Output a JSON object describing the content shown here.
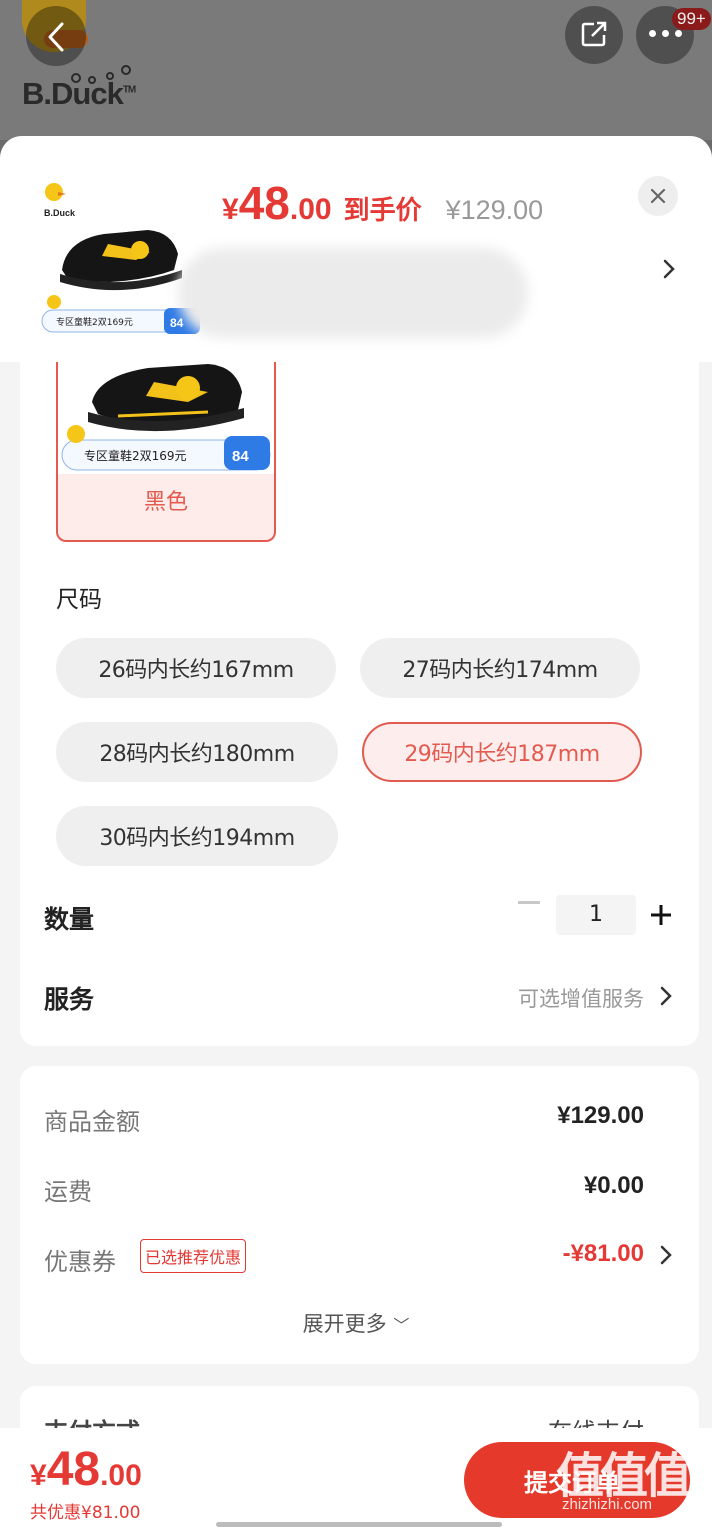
{
  "background": {
    "brand": "B.Duck",
    "trademark": "TM",
    "notification_badge": "99+"
  },
  "header": {
    "price_symbol": "¥",
    "price_integer": "48",
    "price_decimal": ".00",
    "price_tag": "到手价",
    "original_price": "¥129.00"
  },
  "thumbnail": {
    "brand": "B.Duck",
    "promo_text": "专区童鞋2双169元",
    "promo_price": "84"
  },
  "color_options": [
    {
      "label": "黑色",
      "selected": true,
      "promo_text": "专区童鞋2双169元",
      "promo_price": "84"
    }
  ],
  "size_section": {
    "title": "尺码",
    "options": [
      {
        "label": "26码内长约167mm",
        "selected": false
      },
      {
        "label": "27码内长约174mm",
        "selected": false
      },
      {
        "label": "28码内长约180mm",
        "selected": false
      },
      {
        "label": "29码内长约187mm",
        "selected": true
      },
      {
        "label": "30码内长约194mm",
        "selected": false
      }
    ]
  },
  "quantity": {
    "label": "数量",
    "value": "1"
  },
  "service": {
    "label": "服务",
    "hint": "可选增值服务"
  },
  "price_detail": {
    "items": [
      {
        "label": "商品金额",
        "value": "¥129.00"
      },
      {
        "label": "运费",
        "value": "¥0.00"
      },
      {
        "label": "优惠券",
        "value": "-¥81.00",
        "tag": "已选推荐优惠"
      }
    ],
    "expand_label": "展开更多"
  },
  "payment": {
    "label": "支付方式",
    "value": "在线支付"
  },
  "bottom_bar": {
    "total_symbol": "¥",
    "total_integer": "48",
    "total_decimal": ".00",
    "savings": "共优惠¥81.00",
    "submit_label": "提交订单"
  },
  "watermark": {
    "main": "值值值",
    "sub": "zhizhizhi.com"
  },
  "colors": {
    "accent": "#e53935",
    "selected_border": "#e35a50",
    "muted": "#999999"
  }
}
